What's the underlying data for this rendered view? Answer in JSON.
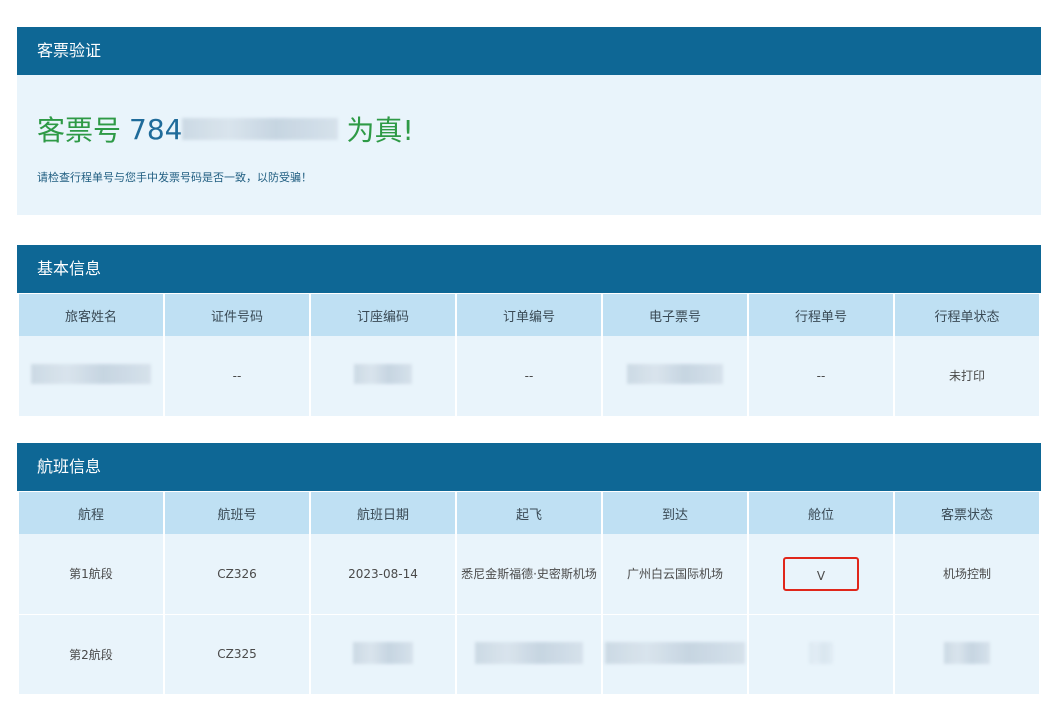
{
  "verify": {
    "header": "客票验证",
    "title_prefix": "客票号",
    "ticket_visible": "784",
    "title_suffix": "为真!",
    "note": "请检查行程单号与您手中发票号码是否一致，以防受骗！"
  },
  "basic": {
    "header": "基本信息",
    "columns": [
      "旅客姓名",
      "证件号码",
      "订座编码",
      "订单编号",
      "电子票号",
      "行程单号",
      "行程单状态"
    ],
    "row": [
      "",
      "--",
      "",
      "--",
      "",
      "--",
      "未打印"
    ]
  },
  "flight": {
    "header": "航班信息",
    "columns": [
      "航程",
      "航班号",
      "航班日期",
      "起飞",
      "到达",
      "舱位",
      "客票状态"
    ],
    "rows": [
      [
        "第1航段",
        "CZ326",
        "2023-08-14",
        "悉尼金斯福德·史密斯机场",
        "广州白云国际机场",
        "V",
        "机场控制"
      ],
      [
        "第2航段",
        "CZ325",
        "",
        "",
        "",
        "",
        ""
      ]
    ]
  },
  "colors": {
    "header_bg": "#0e6795",
    "valid_text": "#2e9a46",
    "highlight_box": "#e0261a"
  }
}
